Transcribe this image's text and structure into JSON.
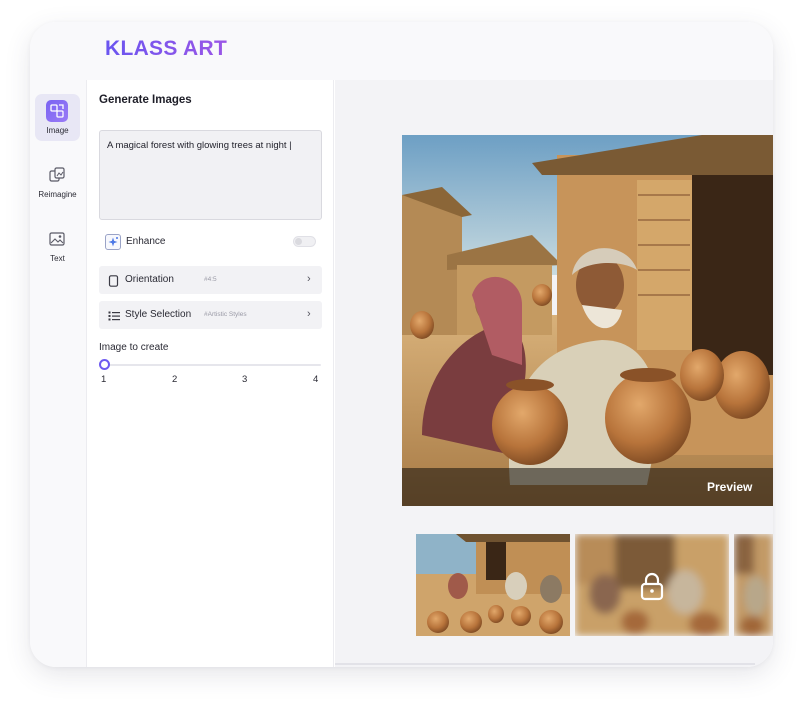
{
  "app": {
    "logo": "KLASS ART"
  },
  "rail": {
    "items": [
      {
        "label": "Image",
        "icon": "image-generate-icon",
        "active": true
      },
      {
        "label": "Reimagine",
        "icon": "reimagine-icon",
        "active": false
      },
      {
        "label": "Text",
        "icon": "text-image-icon",
        "active": false
      }
    ]
  },
  "panel": {
    "title": "Generate Images",
    "prompt_value": "A magical forest with glowing trees at night |",
    "enhance": {
      "label": "Enhance",
      "enabled": false,
      "icon": "sparkle-icon"
    },
    "orientation": {
      "label": "Orientation",
      "hint": "#4:5",
      "icon": "portrait-frame-icon"
    },
    "style": {
      "label": "Style Selection",
      "hint": "#Artistic Styles",
      "icon": "list-icon"
    },
    "count": {
      "label": "Image to create",
      "ticks": [
        "1",
        "2",
        "3",
        "4"
      ],
      "selected": 1
    }
  },
  "preview": {
    "label": "Preview"
  },
  "thumbnails": [
    {
      "locked": false
    },
    {
      "locked": true,
      "icon": "lock-icon"
    },
    {
      "locked": true
    }
  ],
  "colors": {
    "accent": "#6e5bf0",
    "logo_start": "#6a55f0",
    "logo_end": "#9b56e6",
    "rail_active": "#e8e7f5"
  }
}
